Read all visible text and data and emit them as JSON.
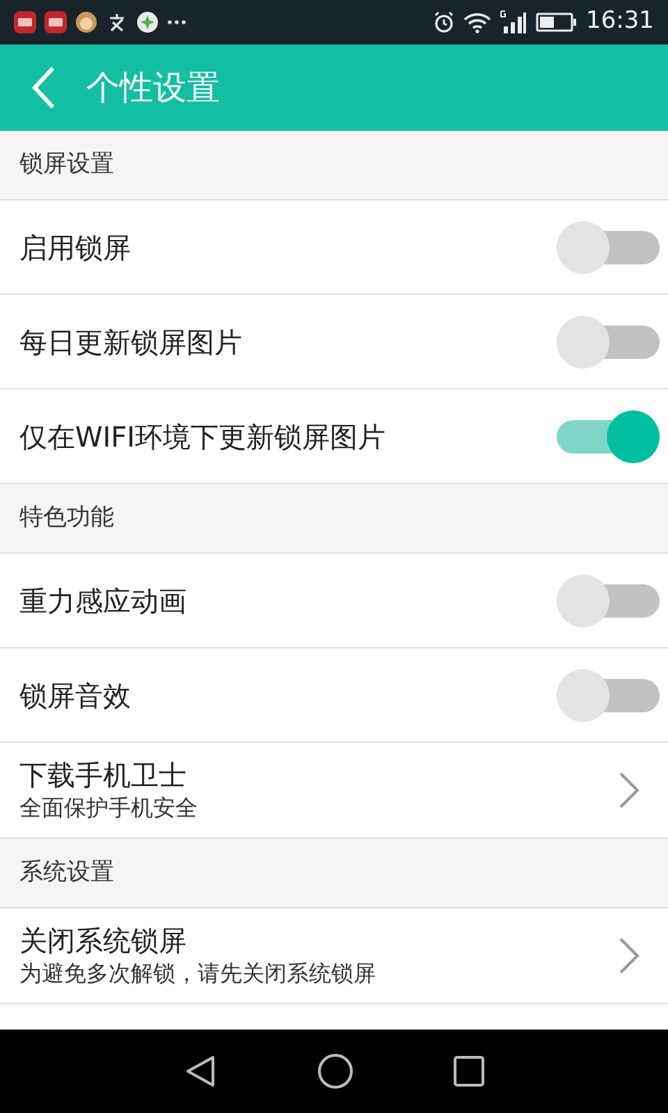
{
  "status_bar": {
    "time": "16:31"
  },
  "app_bar": {
    "title": "个性设置"
  },
  "sections": [
    {
      "header": "锁屏设置",
      "items": [
        {
          "kind": "toggle",
          "label": "启用锁屏",
          "on": false
        },
        {
          "kind": "toggle",
          "label": "每日更新锁屏图片",
          "on": false
        },
        {
          "kind": "toggle",
          "label": "仅在WIFI环境下更新锁屏图片",
          "on": true
        }
      ]
    },
    {
      "header": "特色功能",
      "items": [
        {
          "kind": "toggle",
          "label": "重力感应动画",
          "on": false
        },
        {
          "kind": "toggle",
          "label": "锁屏音效",
          "on": false
        },
        {
          "kind": "link",
          "label": "下载手机卫士",
          "subtitle": "全面保护手机安全"
        }
      ]
    },
    {
      "header": "系统设置",
      "items": [
        {
          "kind": "link",
          "label": "关闭系统锁屏",
          "subtitle": "为避免多次解锁，请先关闭系统锁屏"
        }
      ]
    }
  ]
}
